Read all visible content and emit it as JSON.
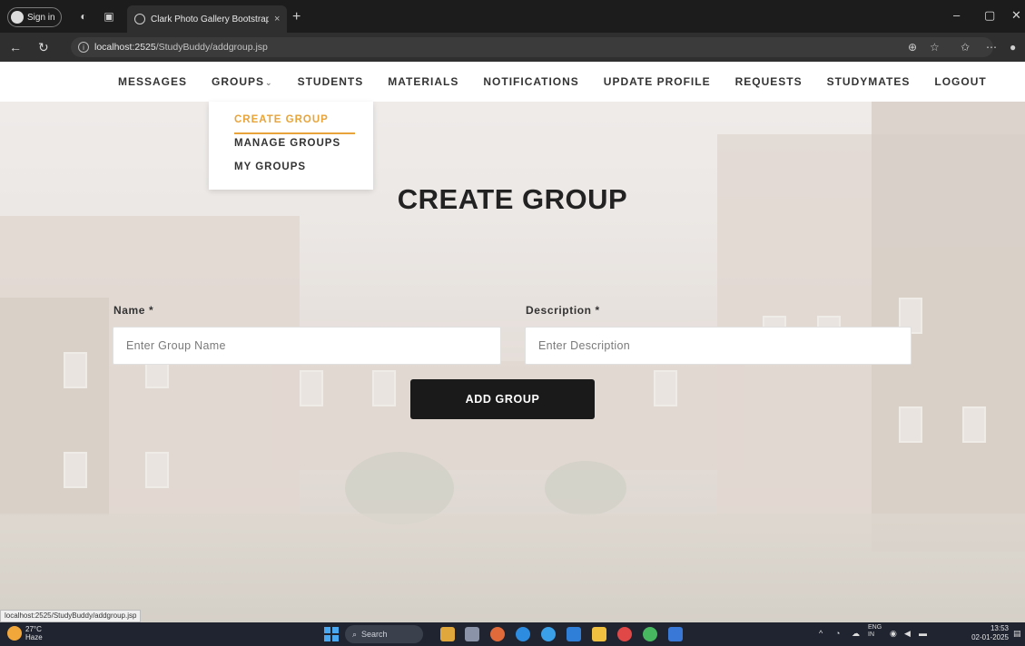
{
  "browser": {
    "signin_label": "Sign in",
    "tab_title": "Clark Photo Gallery Bootstrap Re...",
    "tab_close": "×",
    "new_tab": "+",
    "url_host": "localhost:2525",
    "url_path": "/StudyBuddy/addgroup.jsp",
    "window_controls": [
      "–",
      "▢",
      "✕"
    ]
  },
  "nav": {
    "items": [
      {
        "label": "MESSAGES"
      },
      {
        "label": "GROUPS"
      },
      {
        "label": "STUDENTS"
      },
      {
        "label": "MATERIALS"
      },
      {
        "label": "NOTIFICATIONS"
      },
      {
        "label": "UPDATE PROFILE"
      },
      {
        "label": "REQUESTS"
      },
      {
        "label": "STUDYMATES"
      },
      {
        "label": "LOGOUT"
      }
    ],
    "groups_caret": "⌄"
  },
  "groups_menu": {
    "items": [
      {
        "label": "CREATE GROUP",
        "active": true
      },
      {
        "label": "MANAGE GROUPS",
        "active": false
      },
      {
        "label": "MY GROUPS",
        "active": false
      }
    ],
    "active_color": "#e8a43a"
  },
  "form": {
    "title": "CREATE GROUP",
    "name_label": "Name *",
    "name_placeholder": "Enter Group Name",
    "name_value": "",
    "description_label": "Description *",
    "description_placeholder": "Enter Description",
    "description_value": "",
    "submit_label": "ADD GROUP"
  },
  "status_bar_url": "localhost:2525/StudyBuddy/addgroup.jsp",
  "taskbar": {
    "weather_temp": "27°C",
    "weather_desc": "Haze",
    "search_label": "Search",
    "lang_line1": "ENG",
    "lang_line2": "IN",
    "time": "13:53",
    "date": "02-01-2025"
  }
}
